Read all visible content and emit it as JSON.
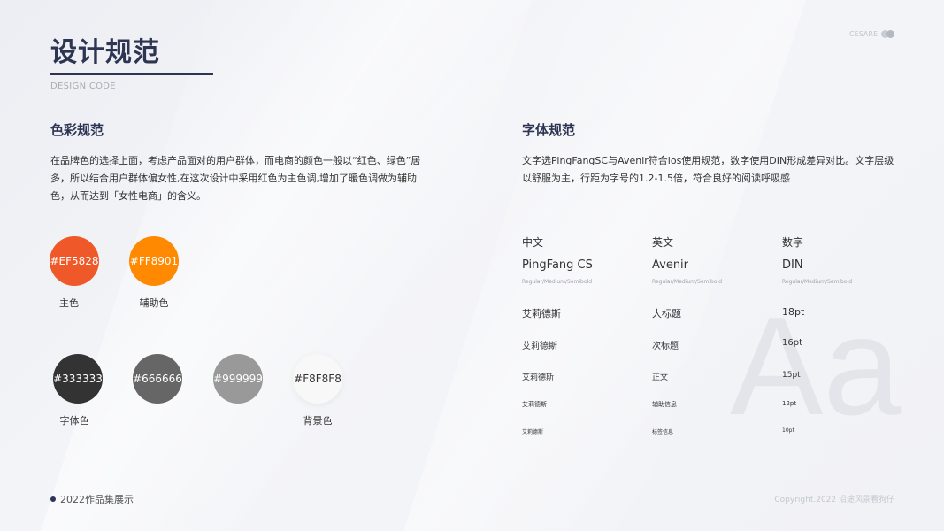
{
  "header": {
    "title": "设计规范",
    "subtitle": "DESIGN CODE",
    "brand": "CESARE"
  },
  "colors": {
    "section_title": "色彩规范",
    "description": "在品牌色的选择上面，考虑产品面对的用户群体，而电商的颜色一般以“红色、绿色”居多，所以结合用户群体偏女性,在这次设计中采用红色为主色调,增加了暖色调做为辅助色，从而达到「女性电商」的含义。",
    "swatches": [
      {
        "hex": "#EF5828",
        "label": "主色",
        "color": "#EF5828"
      },
      {
        "hex": "#FF8901",
        "label": "辅助色",
        "color": "#FF8901"
      },
      {
        "hex": "#333333",
        "label": "字体色",
        "color": "#333333"
      },
      {
        "hex": "#666666",
        "label": "",
        "color": "#666666"
      },
      {
        "hex": "#999999",
        "label": "",
        "color": "#999999"
      },
      {
        "hex": "#F8F8F8",
        "label": "背景色",
        "color": "#F8F8F8"
      }
    ]
  },
  "typography": {
    "section_title": "字体规范",
    "description": "文字选PingFangSC与Avenir符合ios使用规范，数字使用DIN形成差异对比。文字层级以舒服为主，行距为字号的1.2-1.5倍，符合良好的阅读呼吸感",
    "columns": [
      {
        "heading": "中文",
        "font": "PingFang  CS",
        "weights": "Regular/Medium/Semibold",
        "samples": [
          "艾莉德斯",
          "艾莉德斯",
          "艾莉德斯",
          "艾莉德斯",
          "艾莉德斯"
        ]
      },
      {
        "heading": "英文",
        "font": "Avenir",
        "weights": "Regular/Medium/Semibold",
        "samples": [
          "大标题",
          "次标题",
          "正文",
          "辅助信息",
          "标签信息"
        ]
      },
      {
        "heading": "数字",
        "font": "DIN",
        "weights": "Regular/Medium/Semibold",
        "samples": [
          "18pt",
          "16pt",
          "15pt",
          "12pt",
          "10pt"
        ]
      }
    ],
    "watermark": "Aa"
  },
  "footer": {
    "left": "2022作品集展示",
    "right": "Copyright.2022 沿途风景看狗仔"
  }
}
